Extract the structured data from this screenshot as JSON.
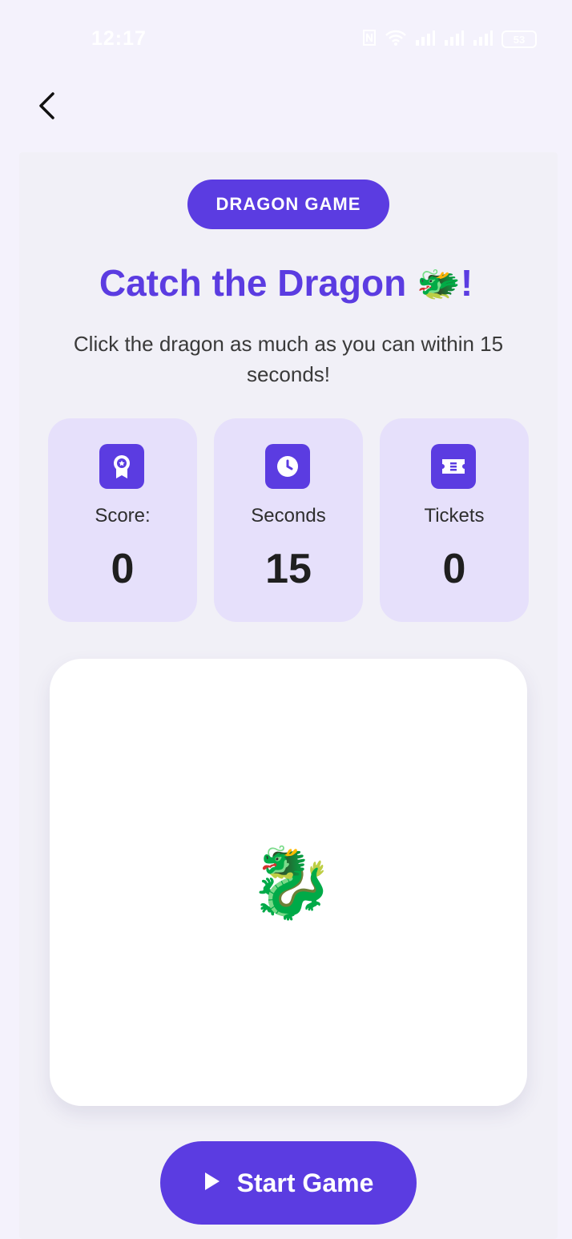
{
  "status_bar": {
    "time": "12:17",
    "battery": "53"
  },
  "header": {
    "back_icon": "chevron-left-icon"
  },
  "game": {
    "badge": "DRAGON GAME",
    "title": "Catch the Dragon",
    "title_emoji": "🐲",
    "title_suffix": "!",
    "instructions": "Click the dragon as much as you can within 15 seconds!",
    "stats": [
      {
        "icon": "award-icon",
        "label": "Score:",
        "value": "0"
      },
      {
        "icon": "clock-icon",
        "label": "Seconds",
        "value": "15"
      },
      {
        "icon": "ticket-icon",
        "label": "Tickets",
        "value": "0"
      }
    ],
    "dragon_emoji": "🐉",
    "start_button_label": "Start Game",
    "start_button_icon": "play-icon"
  },
  "colors": {
    "accent": "#5b3ce1",
    "stat_background": "#e6e0fb",
    "page_background": "#f4f2fc"
  }
}
